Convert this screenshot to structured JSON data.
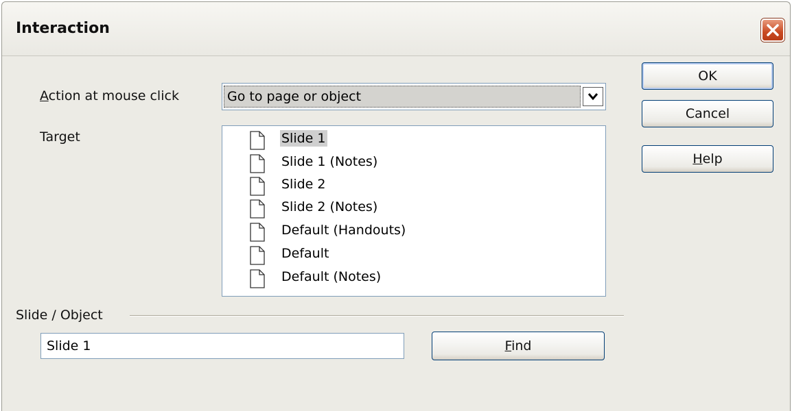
{
  "dialog": {
    "title": "Interaction"
  },
  "action": {
    "label_accel": "A",
    "label_rest": "ction at mouse click",
    "selected_value": "Go to page or object"
  },
  "target": {
    "label": "Target",
    "items": [
      {
        "label": "Slide 1",
        "selected": true
      },
      {
        "label": "Slide 1 (Notes)",
        "selected": false
      },
      {
        "label": "Slide 2",
        "selected": false
      },
      {
        "label": "Slide 2 (Notes)",
        "selected": false
      },
      {
        "label": "Default (Handouts)",
        "selected": false
      },
      {
        "label": "Default",
        "selected": false
      },
      {
        "label": "Default (Notes)",
        "selected": false
      }
    ]
  },
  "slide_object": {
    "group_label": "Slide / Object",
    "value": "Slide 1",
    "find_accel": "F",
    "find_rest": "ind"
  },
  "buttons": {
    "ok": "OK",
    "cancel": "Cancel",
    "help_accel": "H",
    "help_rest": "elp"
  },
  "icons": {
    "close": "close-icon",
    "dropdown": "chevron-down-icon",
    "page": "page-icon"
  }
}
